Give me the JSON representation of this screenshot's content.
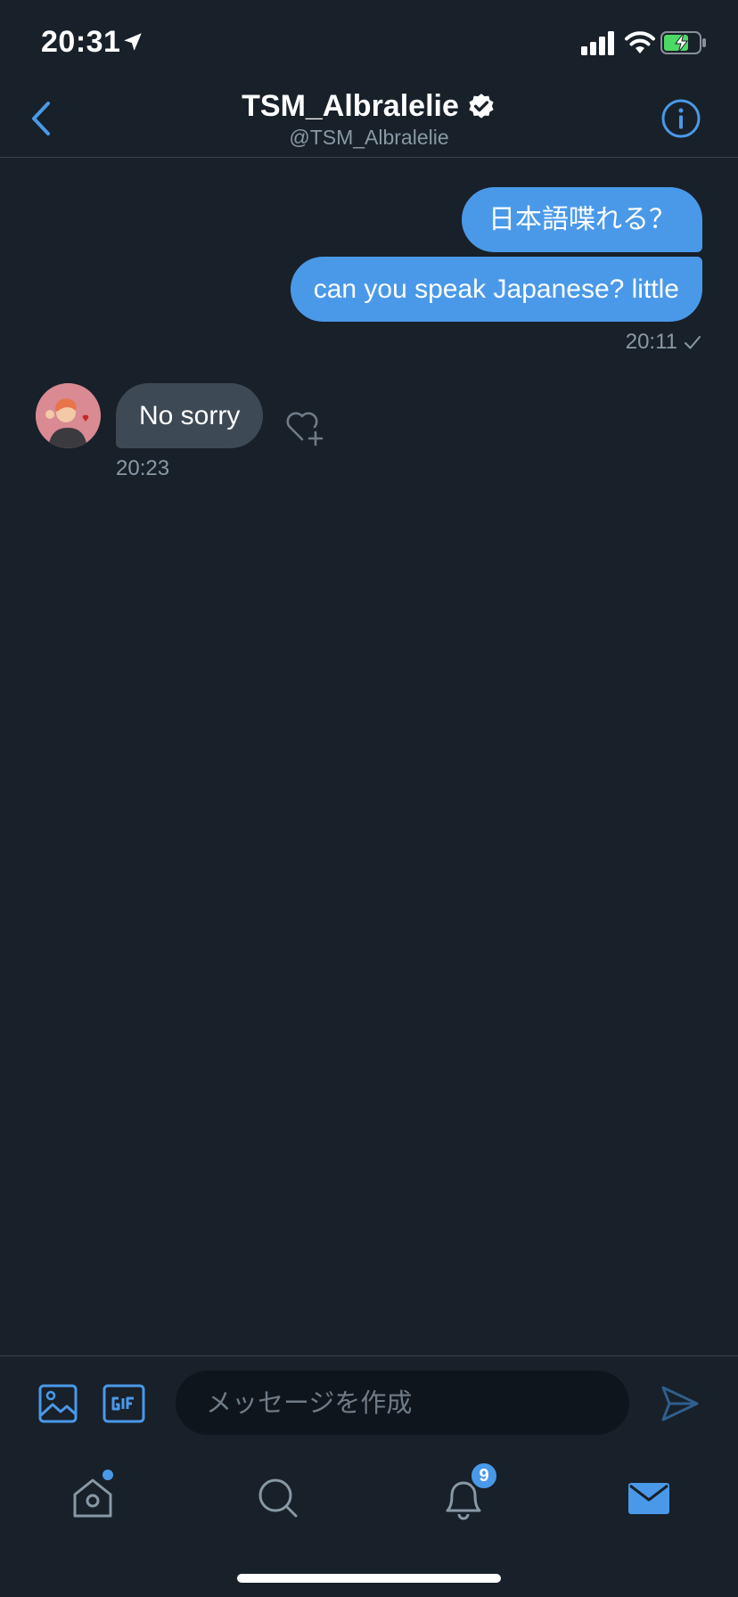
{
  "status_bar": {
    "time": "20:31"
  },
  "header": {
    "name": "TSM_Albralelie",
    "handle": "@TSM_Albralelie",
    "verified": true
  },
  "conversation": {
    "sent_messages": [
      {
        "text": "日本語喋れる？"
      },
      {
        "text": "can you speak Japanese? little"
      }
    ],
    "sent_timestamp": "20:11",
    "received_messages": [
      {
        "text": "No sorry"
      }
    ],
    "received_timestamp": "20:23"
  },
  "composer": {
    "placeholder": "メッセージを作成"
  },
  "tab_bar": {
    "notifications_badge": "9",
    "active_tab": "messages"
  },
  "colors": {
    "background": "#182029",
    "accent": "#4a99e9",
    "received_bubble": "#3d4a56",
    "secondary_text": "#8899a6",
    "divider": "#38444d"
  }
}
